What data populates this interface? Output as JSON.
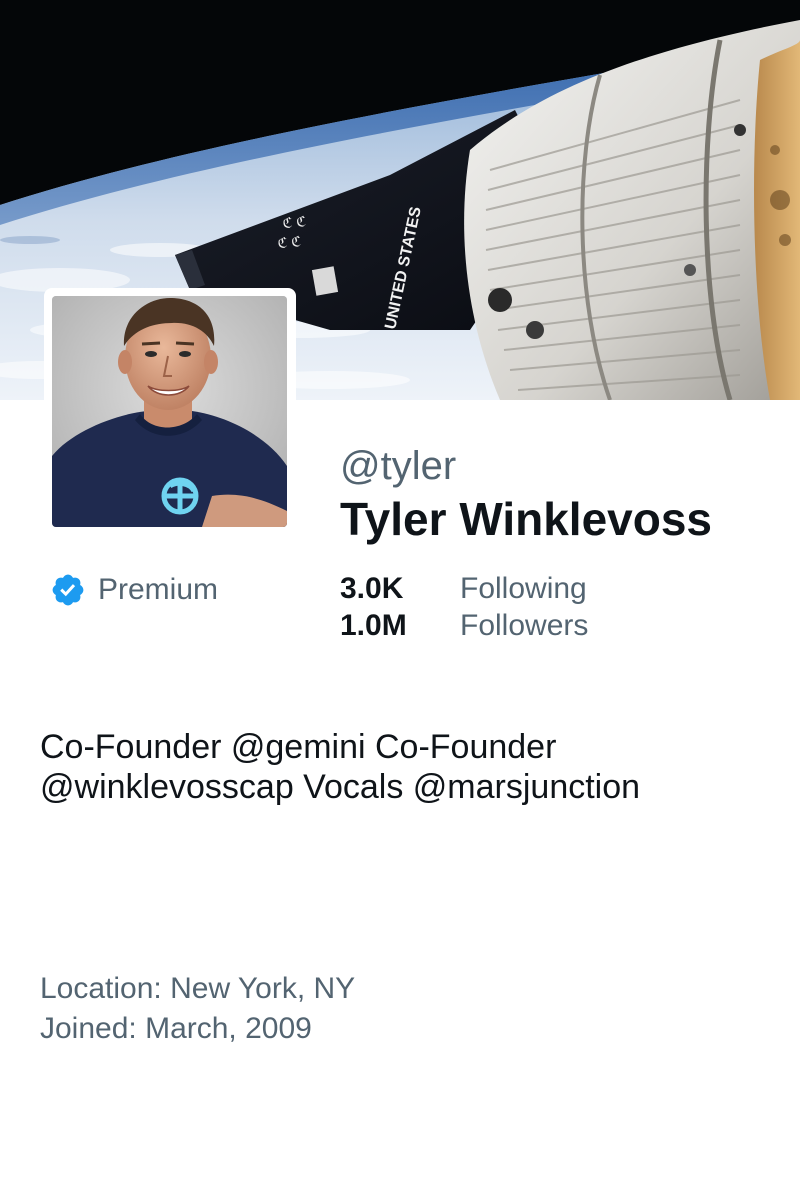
{
  "profile": {
    "handle": "@tyler",
    "display_name": "Tyler Winklevoss",
    "premium_label": "Premium",
    "bio": "Co-Founder @gemini Co-Founder @winklevosscap Vocals @marsjunction",
    "location": "Location: New York, NY",
    "joined": "Joined: March, 2009"
  },
  "stats": {
    "following_value": "3.0K",
    "following_label": "Following",
    "followers_value": "1.0M",
    "followers_label": "Followers"
  },
  "icons": {
    "verified": "verified-badge-icon"
  },
  "colors": {
    "verified_blue": "#1d9bf0",
    "secondary_text": "#536471",
    "primary_text": "#0f1419"
  }
}
